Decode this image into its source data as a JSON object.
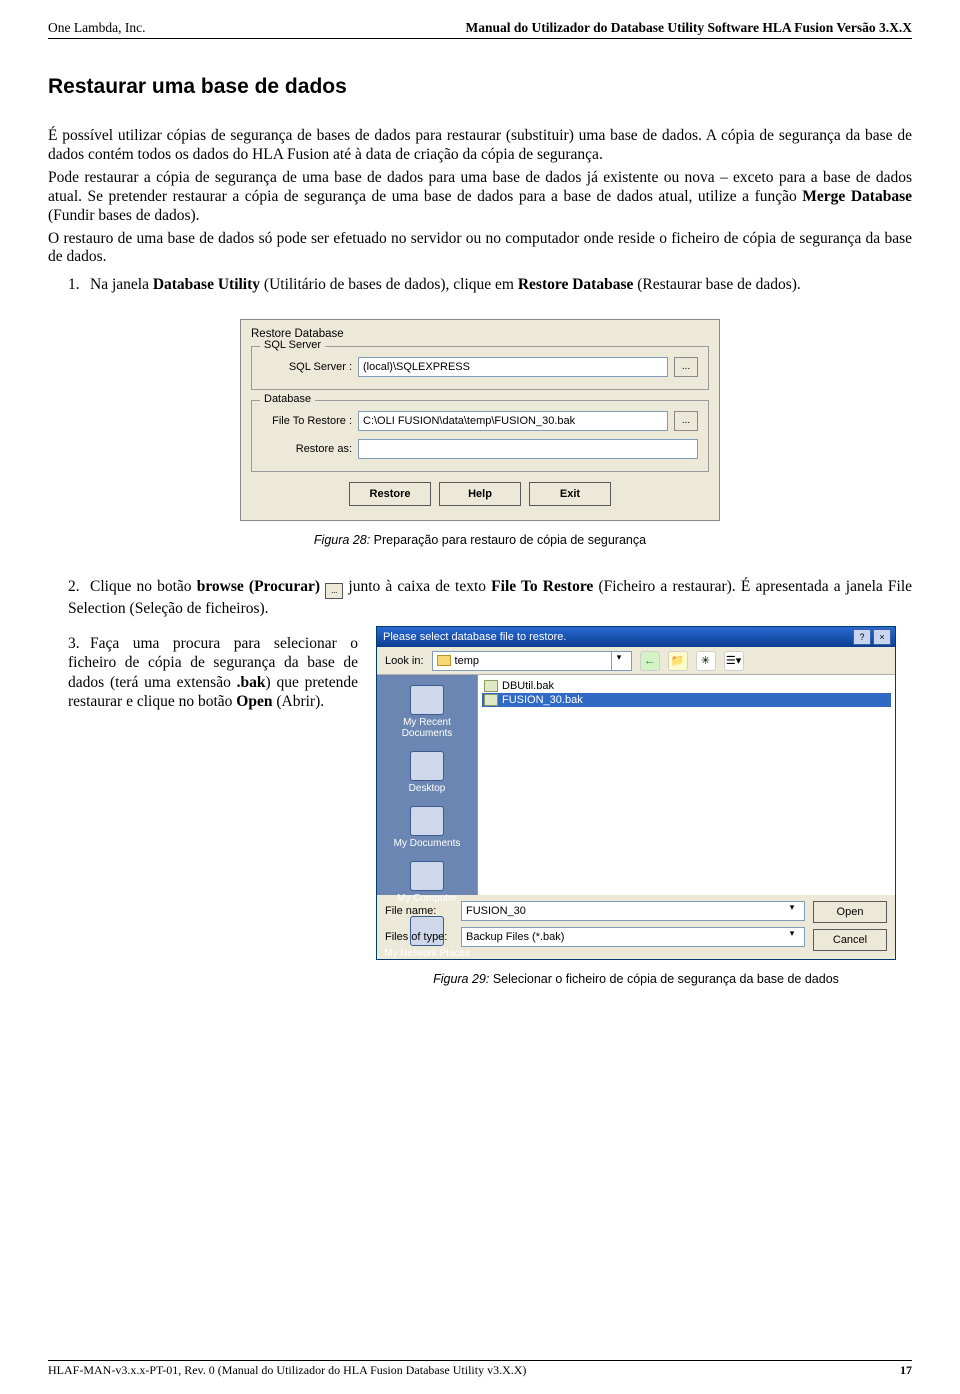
{
  "header": {
    "company": "One Lambda, Inc.",
    "doc_title": "Manual do Utilizador do Database Utility Software HLA Fusion Versão 3.X.X"
  },
  "section_title": "Restaurar uma base de dados",
  "paragraphs": {
    "p1": "É possível utilizar cópias de segurança de bases de dados para restaurar (substituir) uma base de dados. A cópia de segurança da base de dados contém todos os dados do HLA Fusion até à data de criação da cópia de segurança.",
    "p2": "Pode restaurar a cópia de segurança de uma base de dados para uma base de dados já existente ou nova – exceto para a base de dados atual. Se pretender restaurar a cópia de segurança de uma base de dados para a base de dados atual, utilize a função Merge Database (Fundir bases de dados).",
    "p2_bold": "Merge Database",
    "p3": "O restauro de uma base de dados só pode ser efetuado no servidor ou no computador onde reside o ficheiro de cópia de segurança da base de dados."
  },
  "steps": {
    "s1_pre": "Na janela ",
    "s1_b1": "Database Utility",
    "s1_mid": " (Utilitário de bases de dados), clique em ",
    "s1_b2": "Restore Database",
    "s1_post": " (Restaurar base de dados).",
    "s2_pre": "Clique no botão ",
    "s2_b1": "browse (Procurar)",
    "s2_mid": " junto à caixa de texto ",
    "s2_b2": "File To Restore",
    "s2_post": " (Ficheiro a restaurar). É apresentada a janela File Selection (Seleção de ficheiros).",
    "s3_pre": "Faça uma procura para selecionar o ficheiro de cópia de segurança da base de dados (terá uma extensão ",
    "s3_b1": ".bak",
    "s3_mid": ") que pretende restaurar e clique no botão ",
    "s3_b2": "Open",
    "s3_post": " (Abrir)."
  },
  "restore_dialog": {
    "title": "Restore Database",
    "sql_legend": "SQL Server",
    "sql_label": "SQL Server :",
    "sql_value": "(local)\\SQLEXPRESS",
    "db_legend": "Database",
    "file_label": "File To Restore :",
    "file_value": "C:\\OLI FUSION\\data\\temp\\FUSION_30.bak",
    "restore_as_label": "Restore as:",
    "restore_as_value": "",
    "browse_glyph": "...",
    "btn_restore": "Restore",
    "btn_help": "Help",
    "btn_exit": "Exit"
  },
  "fig28": {
    "label": "Figura 28:",
    "caption": " Preparação para restauro de cópia de segurança"
  },
  "file_dialog": {
    "title": "Please select database file to restore.",
    "help_glyph": "?",
    "close_glyph": "×",
    "lookin_label": "Look in:",
    "lookin_value": "temp",
    "places": [
      "My Recent Documents",
      "Desktop",
      "My Documents",
      "My Computer",
      "My Network Places"
    ],
    "files": [
      "DBUtil.bak",
      "FUSION_30.bak"
    ],
    "selected_index": 1,
    "filename_label": "File name:",
    "filename_value": "FUSION_30",
    "filetype_label": "Files of type:",
    "filetype_value": "Backup Files (*.bak)",
    "btn_open": "Open",
    "btn_cancel": "Cancel"
  },
  "fig29": {
    "label": "Figura 29:",
    "caption": " Selecionar o ficheiro de cópia de segurança da base de dados"
  },
  "footer": {
    "left": "HLAF-MAN-v3.x.x-PT-01, Rev. 0 (Manual do Utilizador do HLA Fusion Database Utility v3.X.X)",
    "page": "17"
  }
}
